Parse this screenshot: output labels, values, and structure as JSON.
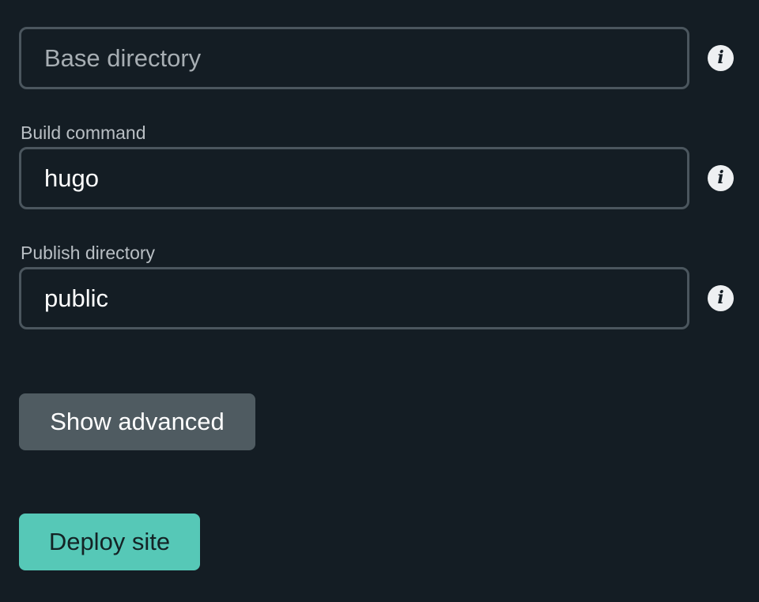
{
  "form": {
    "base_directory": {
      "label": "",
      "value": "",
      "placeholder": "Base directory"
    },
    "build_command": {
      "label": "Build command",
      "value": "hugo",
      "placeholder": ""
    },
    "publish_directory": {
      "label": "Publish directory",
      "value": "public",
      "placeholder": ""
    },
    "info_icon_glyph": "i"
  },
  "actions": {
    "show_advanced_label": "Show advanced",
    "deploy_label": "Deploy site"
  },
  "colors": {
    "background": "#141d24",
    "input_border": "#4b565e",
    "label_text": "#b9bfc4",
    "secondary_button": "#4f5b61",
    "primary_button": "#56c8b7",
    "primary_button_text": "#142325"
  },
  "icons": {
    "field_help": "info-icon"
  }
}
